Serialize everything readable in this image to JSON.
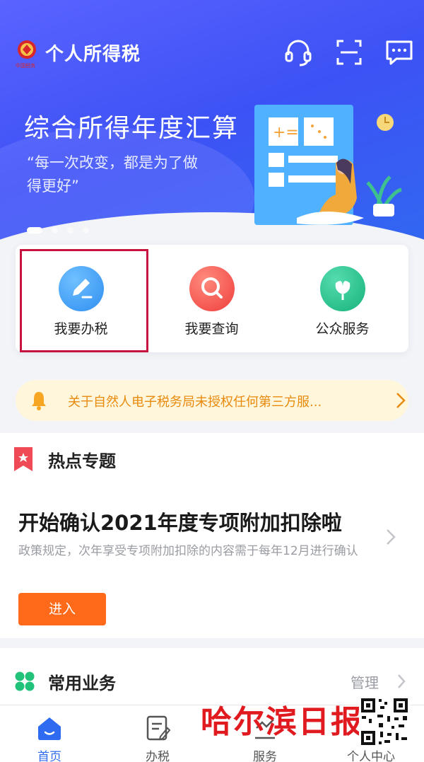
{
  "header": {
    "app_title": "个人所得税",
    "logo_icon": "tax-emblem-icon",
    "logo_text": "中国税务",
    "icons": [
      "headset-icon",
      "scan-icon",
      "chat-icon"
    ]
  },
  "banner": {
    "title": "综合所得年度汇算",
    "subtitle": "“每一次改变，都是为了做得更好”",
    "slide_count": 4,
    "active_slide": 1
  },
  "quick_actions": [
    {
      "label": "我要办税",
      "icon": "pencil-icon",
      "color": "#3aa2f5"
    },
    {
      "label": "我要查询",
      "icon": "search-icon",
      "color": "#f0524c"
    },
    {
      "label": "公众服务",
      "icon": "flower-icon",
      "color": "#27c48d"
    }
  ],
  "notice": {
    "text": "关于自然人电子税务局未授权任何第三方服...",
    "icon": "bell-icon"
  },
  "hot_topics": {
    "title": "热点专题",
    "article_title": "开始确认2021年度专项附加扣除啦",
    "article_desc": "政策规定，次年享受专项附加扣除的内容需于每年12月进行确认",
    "enter_label": "进入"
  },
  "common_services": {
    "title": "常用业务",
    "manage_label": "管理"
  },
  "bottom_nav": [
    {
      "label": "首页",
      "icon": "home-icon",
      "active": true
    },
    {
      "label": "办税",
      "icon": "tax-form-icon",
      "active": false
    },
    {
      "label": "服务",
      "icon": "service-icon",
      "active": false
    },
    {
      "label": "个人中心",
      "icon": "user-icon",
      "active": false
    }
  ],
  "watermark": {
    "text": "哈尔滨日报"
  },
  "colors": {
    "brand_blue": "#2f6bf0",
    "highlight_red": "#c7133f",
    "notice_orange": "#e88a0c",
    "enter_orange": "#ff6a1a"
  }
}
